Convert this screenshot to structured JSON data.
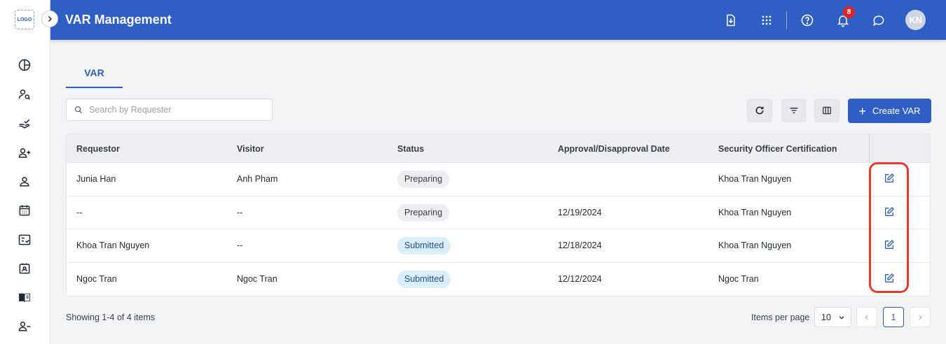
{
  "sidebar": {
    "logo_text": "LOGO",
    "items": [
      {
        "icon": "pie-chart-icon"
      },
      {
        "icon": "user-search-icon"
      },
      {
        "icon": "hand-check-icon"
      },
      {
        "icon": "user-add-icon"
      },
      {
        "icon": "user-icon"
      },
      {
        "icon": "calendar-icon"
      },
      {
        "icon": "checklist-icon"
      },
      {
        "icon": "id-badge-icon"
      },
      {
        "icon": "book-icon"
      },
      {
        "icon": "user-remove-icon"
      }
    ]
  },
  "header": {
    "title": "VAR Management",
    "notification_count": "8",
    "avatar_initials": "KN"
  },
  "tabs": [
    {
      "label": "VAR"
    }
  ],
  "search": {
    "placeholder": "Search by Requester",
    "value": ""
  },
  "toolbar": {
    "create_label": "Create VAR"
  },
  "table": {
    "columns": [
      "Requestor",
      "Visitor",
      "Status",
      "Approval/Disapproval Date",
      "Security Officer Certification"
    ],
    "rows": [
      {
        "requestor": "Junia Han",
        "visitor": "Anh Pham",
        "status": "Preparing",
        "date": "",
        "officer": "Khoa Tran Nguyen"
      },
      {
        "requestor": "--",
        "visitor": "--",
        "status": "Preparing",
        "date": "12/19/2024",
        "officer": "Khoa Tran Nguyen"
      },
      {
        "requestor": "Khoa Tran Nguyen",
        "visitor": "--",
        "status": "Submitted",
        "date": "12/18/2024",
        "officer": "Khoa Tran Nguyen"
      },
      {
        "requestor": "Ngoc Tran",
        "visitor": "Ngoc Tran",
        "status": "Submitted",
        "date": "12/12/2024",
        "officer": "Ngoc Tran"
      }
    ]
  },
  "footer": {
    "showing": "Showing 1-4 of 4 items",
    "items_per_page_label": "Items per page",
    "items_per_page_value": "10",
    "current_page": "1"
  },
  "colors": {
    "primary": "#2f5fc4",
    "highlight": "#e53b2b",
    "badge": "#dc2626"
  }
}
